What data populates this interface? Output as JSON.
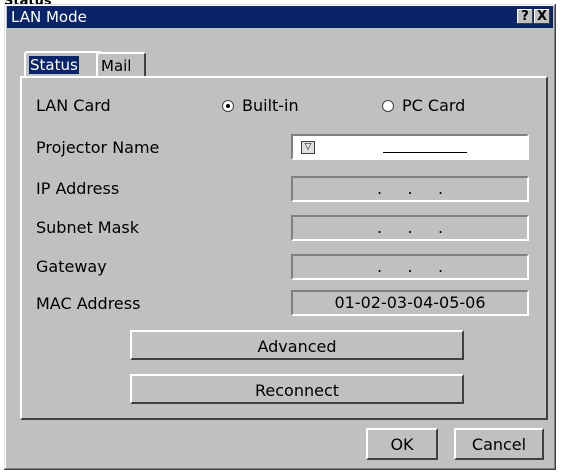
{
  "above_label": "Status",
  "window": {
    "title": "LAN Mode",
    "help_button": "?",
    "close_button": "X"
  },
  "tabs": [
    {
      "label": "Status",
      "active": true
    },
    {
      "label": "Mail",
      "active": false
    }
  ],
  "lan_card": {
    "label": "LAN Card",
    "options": [
      {
        "label": "Built-in",
        "selected": true
      },
      {
        "label": "PC Card",
        "selected": false
      }
    ]
  },
  "fields": [
    {
      "label": "Projector Name",
      "value": ""
    },
    {
      "label": "IP Address",
      "value": ".     .     ."
    },
    {
      "label": "Subnet Mask",
      "value": ".     .     ."
    },
    {
      "label": "Gateway",
      "value": ".     .     ."
    },
    {
      "label": "MAC Address",
      "value": "01-02-03-04-05-06"
    }
  ],
  "buttons": {
    "advanced": "Advanced",
    "reconnect": "Reconnect",
    "ok": "OK",
    "cancel": "Cancel"
  }
}
